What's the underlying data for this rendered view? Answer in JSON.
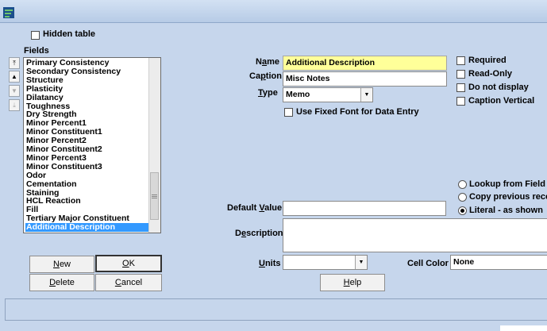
{
  "hidden_table": {
    "label": "Hidden table",
    "checked": false
  },
  "fields_label": "Fields",
  "fields": [
    "Primary Consistency",
    "Secondary Consistency",
    "Structure",
    "Plasticity",
    "Dilatancy",
    "Toughness",
    "Dry Strength",
    "Minor Percent1",
    "Minor Constituent1",
    "Minor Percent2",
    "Minor Constituent2",
    "Minor Percent3",
    "Minor Constituent3",
    "Odor",
    "Cementation",
    "Staining",
    "HCL Reaction",
    "Fill",
    "Tertiary Major Constituent",
    "Additional Description"
  ],
  "selected_field": "Additional Description",
  "form": {
    "name_label_pre": "N",
    "name_label_u": "a",
    "name_label_post": "me",
    "name_value": "Additional Description",
    "caption_label_pre": "Ca",
    "caption_label_u": "p",
    "caption_label_post": "tion",
    "caption_value": "Misc Notes",
    "type_label_pre": "",
    "type_label_u": "T",
    "type_label_post": "ype",
    "type_value": "Memo",
    "fixed_font_label": "Use Fixed Font for Data Entry",
    "default_label_pre": "Default ",
    "default_label_u": "V",
    "default_label_post": "alue",
    "default_value": "",
    "description_label_pre": "D",
    "description_label_u": "e",
    "description_label_post": "scription",
    "description_value": "",
    "units_label_pre": "",
    "units_label_u": "U",
    "units_label_post": "nits",
    "units_value": "",
    "cell_color_label": "Cell Color",
    "cell_color_value": "None"
  },
  "options": {
    "required": "Required",
    "read_only": "Read-Only",
    "do_not_display": "Do not display",
    "caption_vertical": "Caption Vertical"
  },
  "default_source": {
    "lookup": "Lookup from Field",
    "copy_previous": "Copy previous record",
    "literal": "Literal - as shown",
    "selected": "literal"
  },
  "buttons": {
    "new_u": "N",
    "new_rest": "ew",
    "ok_u": "O",
    "ok_rest": "K",
    "delete_u": "D",
    "delete_rest": "elete",
    "cancel_u": "C",
    "cancel_rest": "ancel",
    "help_u": "H",
    "help_rest": "elp"
  }
}
